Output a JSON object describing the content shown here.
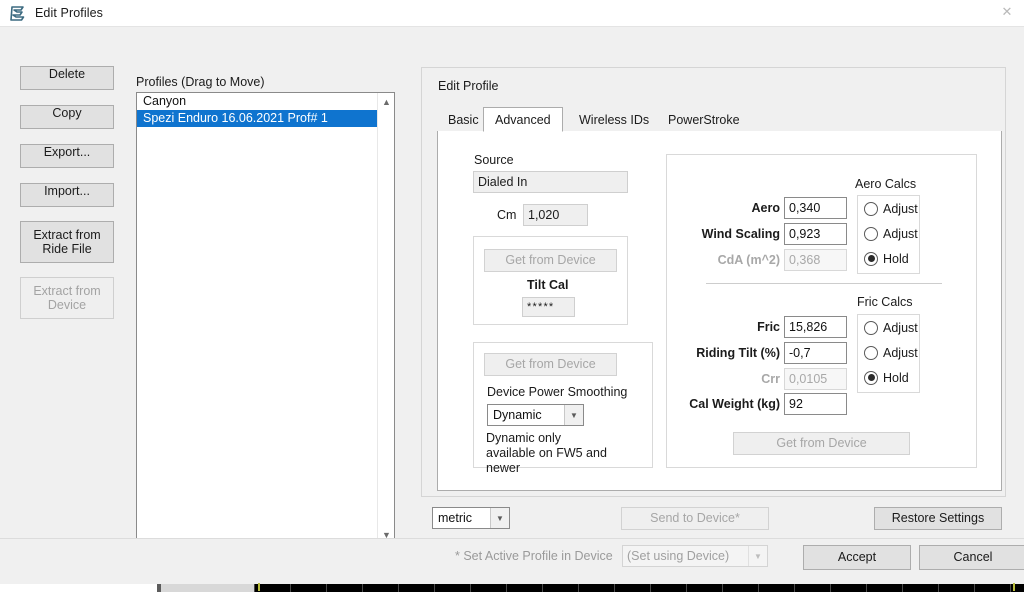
{
  "window": {
    "title": "Edit Profiles",
    "app_icon": "app-icon",
    "close_glyph": "✕"
  },
  "left_buttons": [
    {
      "label": "Delete",
      "disabled": false,
      "two_line": false
    },
    {
      "label": "Copy",
      "disabled": false,
      "two_line": false
    },
    {
      "label": "Export...",
      "disabled": false,
      "two_line": false
    },
    {
      "label": "Import...",
      "disabled": false,
      "two_line": false
    },
    {
      "label_line1": "Extract from",
      "label_line2": "Ride File",
      "disabled": false,
      "two_line": true
    },
    {
      "label_line1": "Extract from",
      "label_line2": "Device",
      "disabled": true,
      "two_line": true
    }
  ],
  "profiles": {
    "label": "Profiles (Drag to Move)",
    "items": [
      {
        "name": "Canyon",
        "selected": false
      },
      {
        "name": "Spezi Enduro 16.06.2021 Prof# 1",
        "selected": true
      }
    ],
    "scroll_up_glyph": "▲",
    "scroll_down_glyph": "▼"
  },
  "edit_profile": {
    "group_title": "Edit Profile",
    "tabs": [
      {
        "label": "Basic",
        "active": false
      },
      {
        "label": "Advanced",
        "active": true
      },
      {
        "label": "Wireless IDs",
        "active": false
      },
      {
        "label": "PowerStroke",
        "active": false
      }
    ],
    "advanced": {
      "source_label": "Source",
      "source_value": "Dialed In",
      "cm_label": "Cm",
      "cm_value": "1,020",
      "tilt_group": {
        "get_from_device_label": "Get from Device",
        "tilt_cal_label": "Tilt Cal",
        "tilt_cal_value": "*****"
      },
      "smoothing_group": {
        "get_from_device_label": "Get from Device",
        "title": "Device Power Smoothing",
        "selected": "Dynamic",
        "note": "Dynamic only available on FW5 and newer",
        "dropdown_glyph": "▼"
      },
      "aero": {
        "title": "Aero Calcs",
        "fields": [
          {
            "label": "Aero",
            "value": "0,340",
            "disabled": false
          },
          {
            "label": "Wind Scaling",
            "value": "0,923",
            "disabled": false
          },
          {
            "label": "CdA (m^2)",
            "value": "0,368",
            "disabled": true
          }
        ],
        "radios": [
          {
            "label": "Adjust",
            "selected": false
          },
          {
            "label": "Adjust",
            "selected": false
          },
          {
            "label": "Hold",
            "selected": true
          }
        ]
      },
      "fric": {
        "title": "Fric Calcs",
        "fields": [
          {
            "label": "Fric",
            "value": "15,826",
            "disabled": false
          },
          {
            "label": "Riding Tilt (%)",
            "value": "-0,7",
            "disabled": false
          },
          {
            "label": "Crr",
            "value": "0,0105",
            "disabled": true
          },
          {
            "label": "Cal Weight (kg)",
            "value": "92",
            "disabled": false
          }
        ],
        "radios": [
          {
            "label": "Adjust",
            "selected": false
          },
          {
            "label": "Adjust",
            "selected": false
          },
          {
            "label": "Hold",
            "selected": true
          }
        ],
        "get_from_device_label": "Get from Device"
      }
    },
    "bottom": {
      "units_value": "metric",
      "units_glyph": "▼",
      "send_to_device_label": "Send to Device*",
      "restore_settings_label": "Restore Settings"
    }
  },
  "footer": {
    "note": "* Set Active Profile in Device",
    "active_profile_value": "(Set using Device)",
    "active_profile_glyph": "▼",
    "accept_label": "Accept",
    "cancel_label": "Cancel"
  },
  "colors": {
    "selection_blue": "#0f74cf",
    "dialog_bg": "#f0f0f0",
    "panel_bg": "#ffffff",
    "button_face": "#e1e1e1",
    "button_border": "#adadad",
    "disabled_text": "#a6a6a6",
    "timeline_marker": "#b9bd3d"
  }
}
